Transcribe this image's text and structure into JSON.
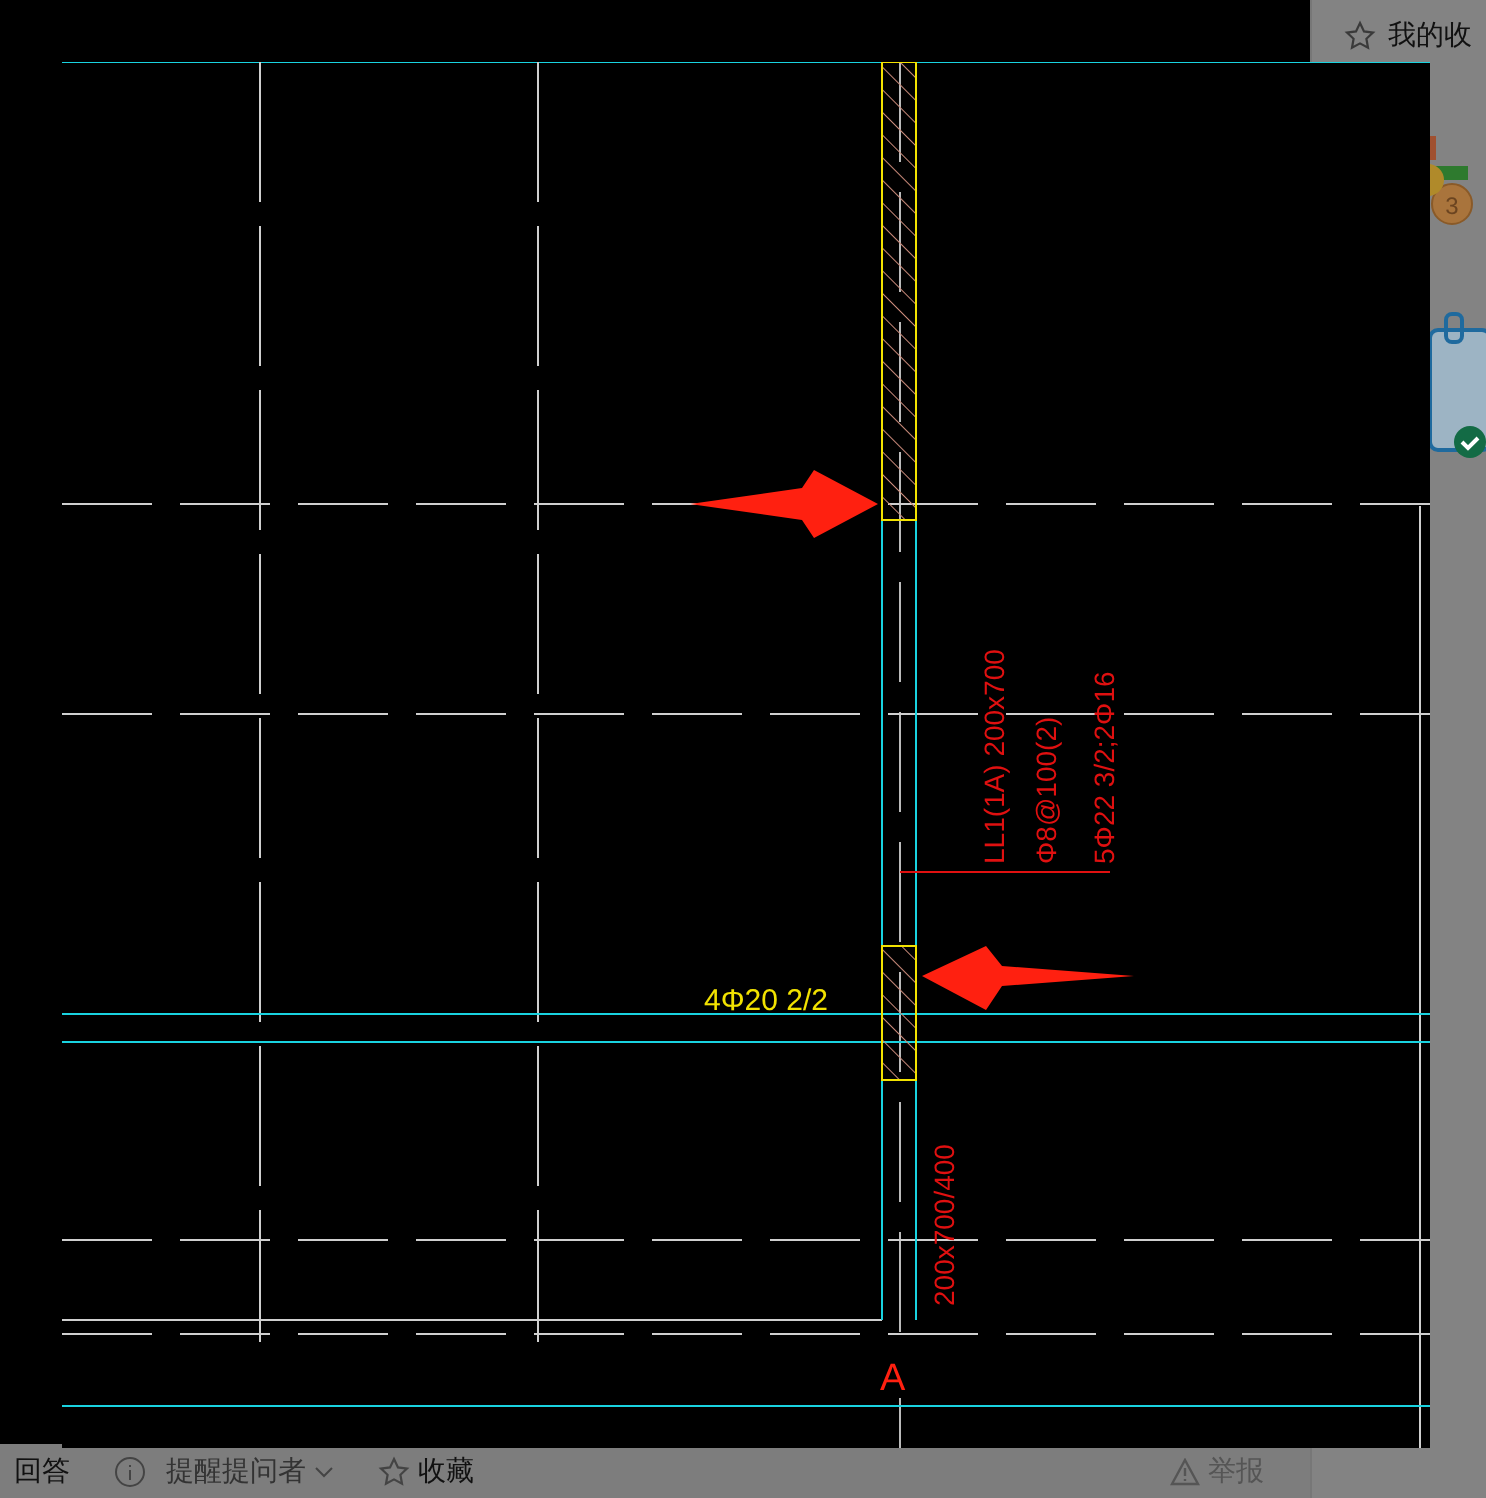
{
  "sidebar": {
    "favorites_label": "我的收"
  },
  "medal": {
    "number": "3"
  },
  "actions": [
    {
      "kind": "plain",
      "label": "回答"
    },
    {
      "kind": "remind",
      "label": "提醒提问者"
    },
    {
      "kind": "star",
      "label": "收藏"
    }
  ],
  "report": {
    "label": "举报"
  },
  "viewer": {
    "beam_labels": [
      "LL1(1A) 200x700",
      "Φ8@100(2)",
      "5Φ22 3/2;2Φ16"
    ],
    "rebar_label": "4Φ20 2/2",
    "column_label": "200x700/400",
    "axis_label": "A"
  }
}
